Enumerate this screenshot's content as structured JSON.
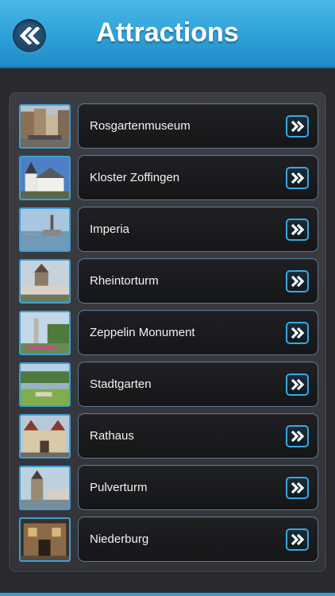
{
  "header": {
    "title": "Attractions",
    "back_icon": "double-chevron-left-icon"
  },
  "colors": {
    "header_blue": "#2fa0d8",
    "accent_border": "#3aa8e0",
    "background": "#2a2b2f"
  },
  "attractions": [
    {
      "label": "Rosgartenmuseum",
      "thumb": "street-square-photo"
    },
    {
      "label": "Kloster Zoffingen",
      "thumb": "church-photo"
    },
    {
      "label": "Imperia",
      "thumb": "harbor-statue-photo"
    },
    {
      "label": "Rheintorturm",
      "thumb": "tower-photo"
    },
    {
      "label": "Zeppelin Monument",
      "thumb": "monument-photo"
    },
    {
      "label": "Stadtgarten",
      "thumb": "park-photo"
    },
    {
      "label": "Rathaus",
      "thumb": "town-hall-photo"
    },
    {
      "label": "Pulverturm",
      "thumb": "round-tower-photo"
    },
    {
      "label": "Niederburg",
      "thumb": "old-building-photo"
    }
  ],
  "row_action_icon": "double-chevron-right-icon"
}
